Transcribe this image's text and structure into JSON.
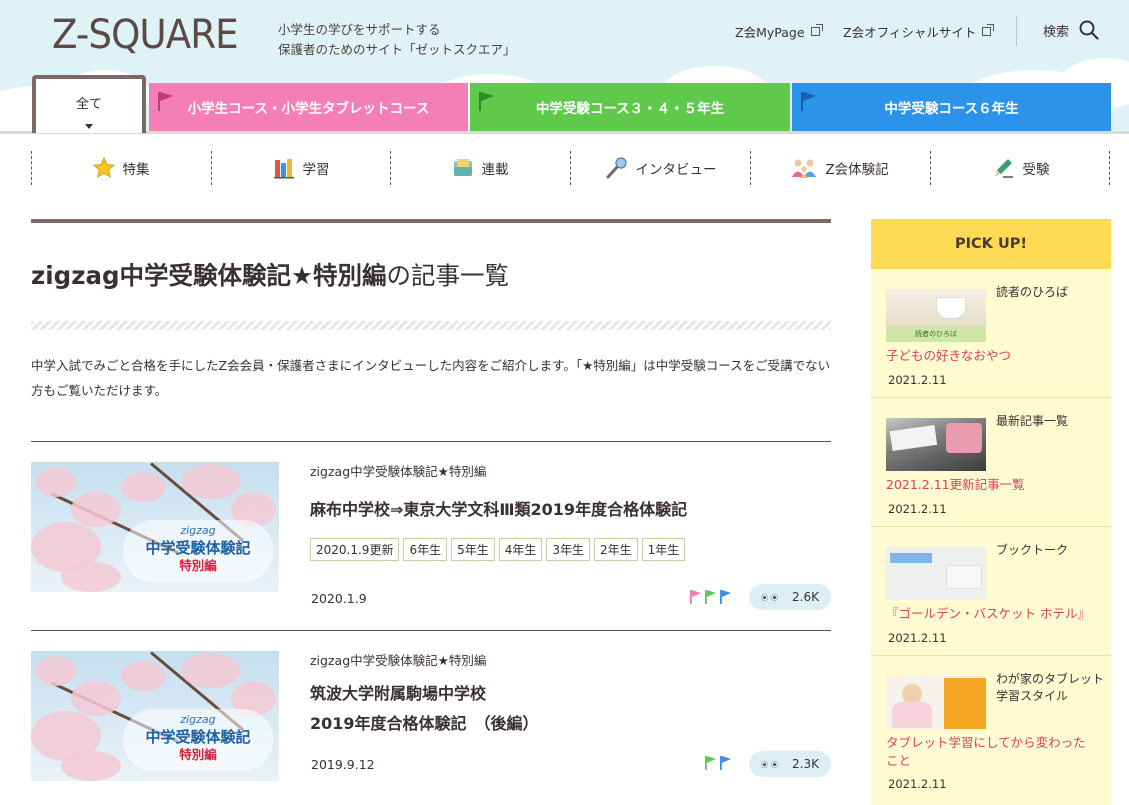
{
  "brand": {
    "logo": "Z-SQUARE",
    "tagline_1": "小学生の学びをサポートする",
    "tagline_2": "保護者のためのサイト「ゼットスクエア」"
  },
  "toplinks": {
    "mypage": "Z会MyPage",
    "official": "Z会オフィシャルサイト",
    "search": "検索"
  },
  "categories": {
    "all": "全て",
    "elementary": "小学生コース・小学生タブレットコース",
    "juken345": "中学受験コース３・４・５年生",
    "juken6": "中学受験コース６年生"
  },
  "nav": [
    "特集",
    "学習",
    "連載",
    "インタビュー",
    "Z会体験記",
    "受験"
  ],
  "page": {
    "title_bold": "zigzag中学受験体験記★特別編",
    "title_light": "の記事一覧",
    "intro": "中学入試でみごと合格を手にしたZ会会員・保護者さまにインタビューした内容をご紹介します。「★特別編」は中学受験コースをご受講でない方もご覧いただけます。"
  },
  "thumb_text": {
    "zigzag": "zigzag",
    "title": "中学受験体験記",
    "special": "特別編"
  },
  "articles": [
    {
      "category": "zigzag中学受験体験記★特別編",
      "title_1": "麻布中学校⇒東京大学文科Ⅲ類2019年度合格体験記",
      "title_2": "",
      "tags": [
        "2020.1.9更新",
        "6年生",
        "5年生",
        "4年生",
        "3年生",
        "2年生",
        "1年生"
      ],
      "date": "2020.1.9",
      "views": "2.6K",
      "flags": [
        "#f07cb4",
        "#5cc85a",
        "#3a8de0"
      ]
    },
    {
      "category": "zigzag中学受験体験記★特別編",
      "title_1": "筑波大学附属駒場中学校",
      "title_2": "2019年度合格体験記　（後編）",
      "tags": [],
      "date": "2019.9.12",
      "views": "2.3K",
      "flags": [
        "#5cc85a",
        "#3a8de0"
      ]
    }
  ],
  "pickup": {
    "heading": "PICK UP!",
    "items": [
      {
        "label": "読者のひろば",
        "title": "子どもの好きなおやつ",
        "date": "2021.2.11",
        "img_caption": "読者のひろば"
      },
      {
        "label": "最新記事一覧",
        "title": "2021.2.11更新記事一覧",
        "date": "2021.2.11",
        "img_caption": ""
      },
      {
        "label": "ブックトーク",
        "title": "『ゴールデン・バスケット ホテル』",
        "date": "2021.2.11",
        "img_caption": ""
      },
      {
        "label": "わが家のタブレット学習スタイル",
        "title": "タブレット学習にしてから変わったこと",
        "date": "2021.2.11",
        "img_caption": ""
      }
    ]
  },
  "colors": {
    "pink": "#f47fb6",
    "green": "#5ec94b",
    "blue": "#2c93ea",
    "brown": "#7e6865",
    "pickup_yellow": "#ffda54"
  }
}
